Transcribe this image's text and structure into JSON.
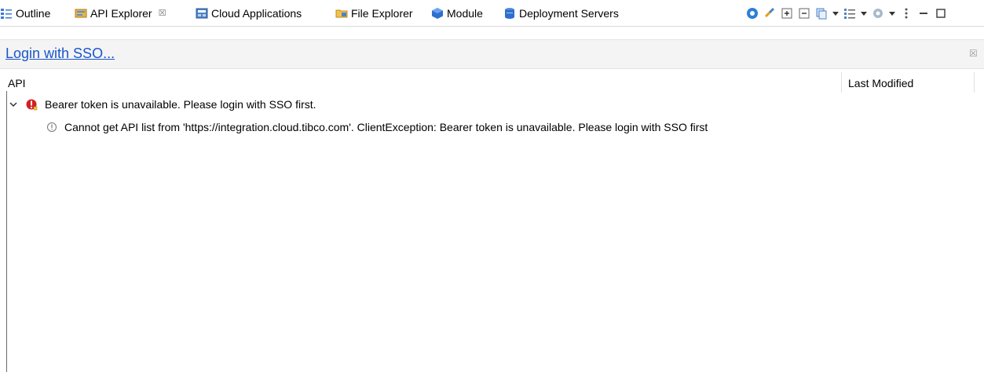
{
  "tabs": [
    {
      "label": "Outline",
      "icon": "outline-icon",
      "active": false
    },
    {
      "label": "API Explorer",
      "icon": "api-explorer-icon",
      "active": true,
      "close": "☒"
    },
    {
      "label": "Cloud Applications",
      "icon": "cloud-applications-icon",
      "active": false
    },
    {
      "label": "File Explorer",
      "icon": "file-explorer-icon",
      "active": false
    },
    {
      "label": "Module",
      "icon": "module-icon",
      "active": false
    },
    {
      "label": "Deployment Servers",
      "icon": "deployment-servers-icon",
      "active": false
    }
  ],
  "toolbar": {
    "icons": [
      "cloud-icon",
      "link-icon",
      "expand-all-icon",
      "collapse-all-icon",
      "copy-icon",
      "view-menu-icon",
      "settings-icon",
      "more-icon",
      "minimize-icon",
      "maximize-icon"
    ]
  },
  "login": {
    "link_label": "Login with SSO...",
    "close_glyph": "☒"
  },
  "table": {
    "columns": [
      "API",
      "Last Modified"
    ],
    "rows": [
      {
        "text": "Bearer token is unavailable. Please login with SSO first.",
        "icon": "error-icon",
        "expanded": true,
        "level": 0
      },
      {
        "text": "Cannot get API list from 'https://integration.cloud.tibco.com'. ClientException:  Bearer token is unavailable. Please login with SSO first",
        "icon": "info-icon",
        "level": 1
      }
    ]
  },
  "colors": {
    "link": "#1a56c9",
    "error": "#d32020",
    "accent": "#2b7fd8"
  }
}
